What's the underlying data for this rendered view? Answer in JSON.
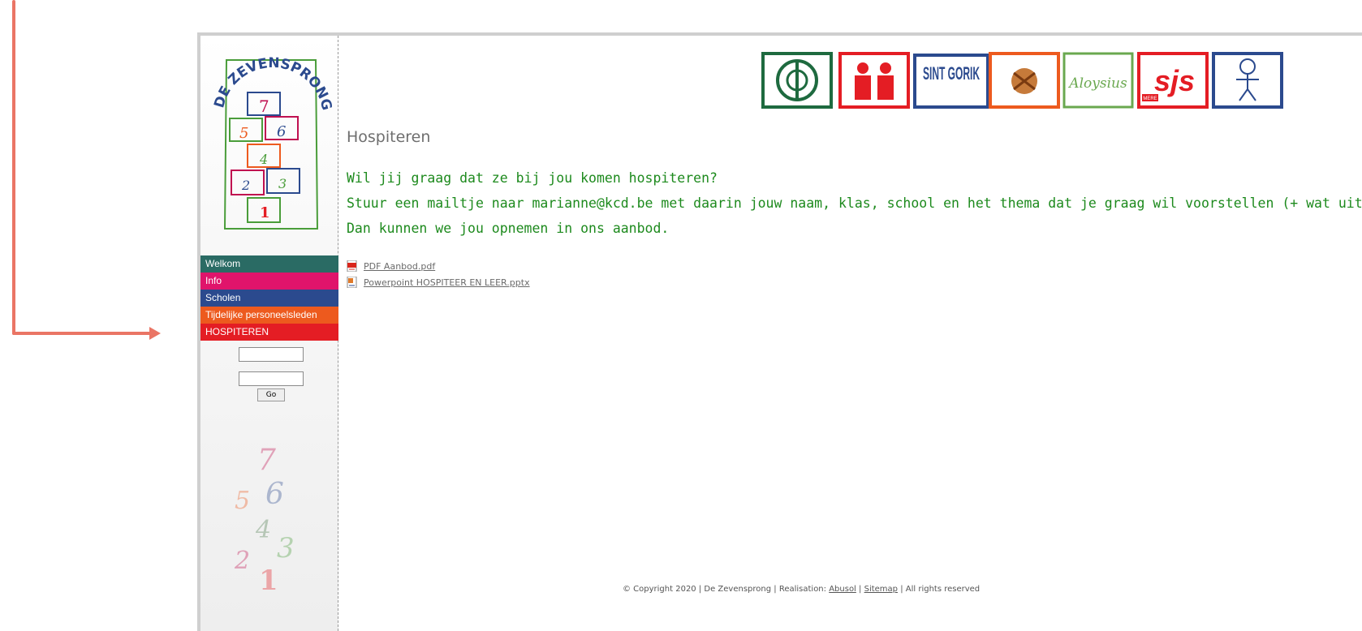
{
  "logo": {
    "title": "DE ZEVENSPRONG",
    "numbers": [
      "7",
      "5",
      "6",
      "4",
      "2",
      "3",
      "1"
    ]
  },
  "menu": [
    {
      "label": "Welkom",
      "color": "#2a6b64"
    },
    {
      "label": "Info",
      "color": "#e0146b"
    },
    {
      "label": "Scholen",
      "color": "#2b4a8e"
    },
    {
      "label": "Tijdelijke personeelsleden",
      "color": "#ed5a1e"
    },
    {
      "label": "HOSPITEREN",
      "color": "#e41d24"
    }
  ],
  "login": {
    "go_label": "Go"
  },
  "banner": {
    "logos": [
      "KCD",
      "people",
      "SINT GORIK",
      "drawing",
      "Aloysius",
      "SJS MERE",
      "stick-figure"
    ],
    "sint_gorik_text": "SINT GORIK",
    "aloysius_text": "Aloysius",
    "sjs_text": "sjs",
    "mere_text": "MERE"
  },
  "content": {
    "title": "Hospiteren",
    "lines": [
      "Wil jij graag dat ze bij jou komen hospiteren?",
      "Stuur een mailtje naar marianne@kcd.be met daarin jouw naam, klas, school en het thema dat je graag wil voorstellen (+ wat uitleg).",
      "Dan kunnen we jou opnemen in ons aanbod."
    ],
    "files": [
      {
        "label": "PDF Aanbod.pdf",
        "icon": "pdf-icon"
      },
      {
        "label": "Powerpoint HOSPITEER EN LEER.pptx",
        "icon": "pptx-icon"
      }
    ]
  },
  "footer": {
    "prefix": "© Copyright 2020 | De Zevensprong | Realisation:",
    "abusol": "Abusol",
    "sep1": "|",
    "sitemap": "Sitemap",
    "suffix": "| All rights reserved"
  },
  "colors": {
    "accent_green": "#1d8a1d",
    "arrow": "#ea7565"
  }
}
